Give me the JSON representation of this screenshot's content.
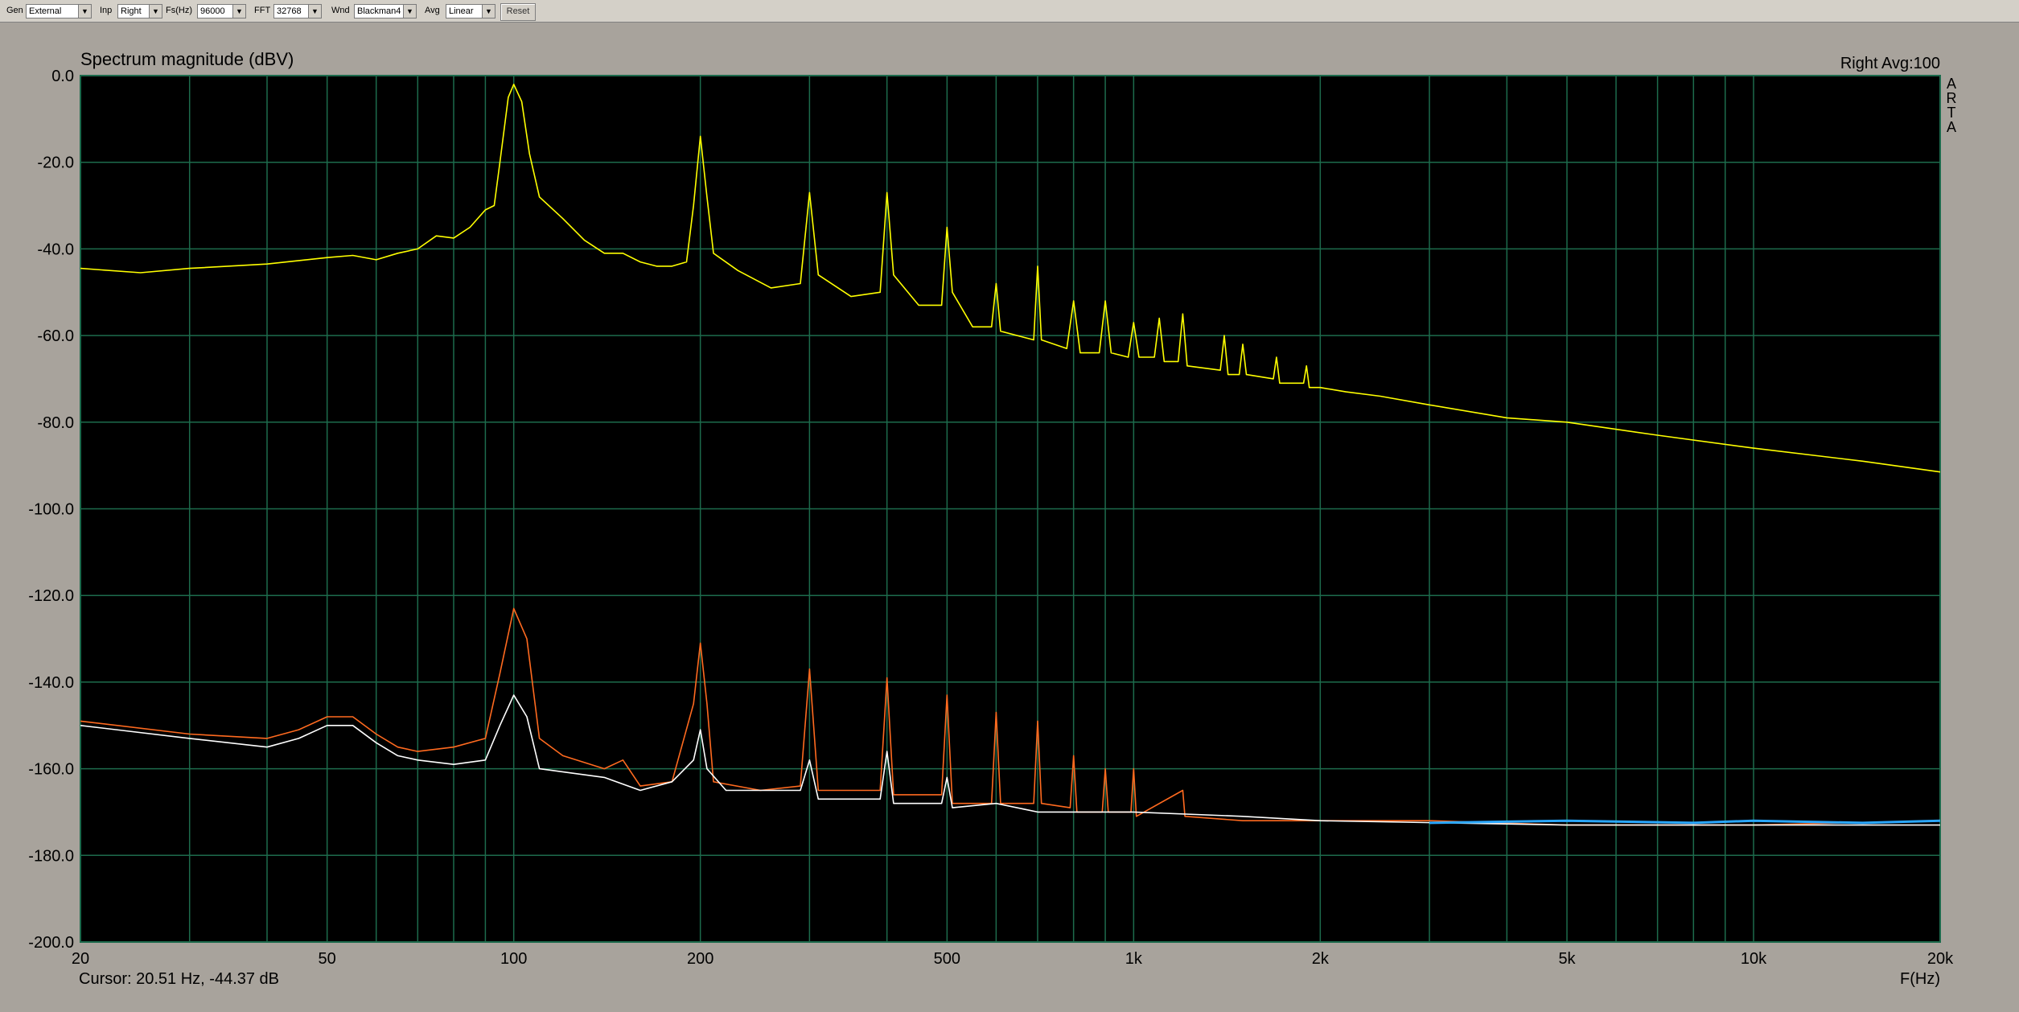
{
  "toolbar": {
    "gen_label": "Gen",
    "gen_value": "External",
    "inp_label": "Inp",
    "inp_value": "Right",
    "fs_label": "Fs(Hz)",
    "fs_value": "96000",
    "fft_label": "FFT",
    "fft_value": "32768",
    "wnd_label": "Wnd",
    "wnd_value": "Blackman4",
    "avg_label": "Avg",
    "avg_value": "Linear",
    "reset_label": "Reset"
  },
  "side_logo": "ARTA",
  "colors": {
    "background": "#000000",
    "grid": "#1d6b4c",
    "yellow": "#ffff00",
    "orange": "#ff6a1f",
    "white": "#ffffff",
    "blue": "#2aa7ff"
  },
  "chart_data": {
    "type": "line",
    "title": "Spectrum magnitude (dBV)",
    "channel_info": "Right  Avg:100",
    "xlabel": "F(Hz)",
    "x_scale": "log",
    "xlim": [
      20,
      20000
    ],
    "ylim": [
      -200,
      0
    ],
    "y_ticks": [
      "0.0",
      "-20.0",
      "-40.0",
      "-60.0",
      "-80.0",
      "-100.0",
      "-120.0",
      "-140.0",
      "-160.0",
      "-180.0",
      "-200.0"
    ],
    "x_tick_labels": [
      "20",
      "50",
      "100",
      "200",
      "500",
      "1k",
      "2k",
      "5k",
      "10k",
      "20k"
    ],
    "x_tick_values": [
      20,
      50,
      100,
      200,
      500,
      1000,
      2000,
      5000,
      10000,
      20000
    ],
    "grid": true,
    "cursor_text": "Cursor: 20.51 Hz, -44.37 dB",
    "series": [
      {
        "color": "#ffff00",
        "points": [
          [
            20,
            -44.5
          ],
          [
            25,
            -45.5
          ],
          [
            30,
            -44.5
          ],
          [
            40,
            -43.5
          ],
          [
            50,
            -42
          ],
          [
            55,
            -41.5
          ],
          [
            60,
            -42.5
          ],
          [
            65,
            -41
          ],
          [
            70,
            -40
          ],
          [
            75,
            -37
          ],
          [
            80,
            -37.5
          ],
          [
            85,
            -35
          ],
          [
            90,
            -31
          ],
          [
            93,
            -30
          ],
          [
            95,
            -20
          ],
          [
            98,
            -5
          ],
          [
            100,
            -2
          ],
          [
            103,
            -6
          ],
          [
            106,
            -18
          ],
          [
            110,
            -28
          ],
          [
            120,
            -33
          ],
          [
            130,
            -38
          ],
          [
            140,
            -41
          ],
          [
            150,
            -41
          ],
          [
            160,
            -43
          ],
          [
            170,
            -44
          ],
          [
            180,
            -44
          ],
          [
            190,
            -43
          ],
          [
            195,
            -30
          ],
          [
            200,
            -14
          ],
          [
            205,
            -28
          ],
          [
            210,
            -41
          ],
          [
            230,
            -45
          ],
          [
            260,
            -49
          ],
          [
            290,
            -48
          ],
          [
            300,
            -27
          ],
          [
            310,
            -46
          ],
          [
            350,
            -51
          ],
          [
            390,
            -50
          ],
          [
            400,
            -27
          ],
          [
            410,
            -46
          ],
          [
            450,
            -53
          ],
          [
            490,
            -53
          ],
          [
            500,
            -35
          ],
          [
            510,
            -50
          ],
          [
            550,
            -58
          ],
          [
            590,
            -58
          ],
          [
            600,
            -48
          ],
          [
            610,
            -59
          ],
          [
            690,
            -61
          ],
          [
            700,
            -44
          ],
          [
            710,
            -61
          ],
          [
            780,
            -63
          ],
          [
            800,
            -52
          ],
          [
            820,
            -64
          ],
          [
            880,
            -64
          ],
          [
            900,
            -52
          ],
          [
            920,
            -64
          ],
          [
            980,
            -65
          ],
          [
            1000,
            -57
          ],
          [
            1020,
            -65
          ],
          [
            1080,
            -65
          ],
          [
            1100,
            -56
          ],
          [
            1120,
            -66
          ],
          [
            1180,
            -66
          ],
          [
            1200,
            -55
          ],
          [
            1220,
            -67
          ],
          [
            1380,
            -68
          ],
          [
            1400,
            -60
          ],
          [
            1420,
            -69
          ],
          [
            1480,
            -69
          ],
          [
            1500,
            -62
          ],
          [
            1520,
            -69
          ],
          [
            1680,
            -70
          ],
          [
            1700,
            -65
          ],
          [
            1720,
            -71
          ],
          [
            1880,
            -71
          ],
          [
            1900,
            -67
          ],
          [
            1920,
            -72
          ],
          [
            2000,
            -72
          ],
          [
            2200,
            -73
          ],
          [
            2500,
            -74
          ],
          [
            3000,
            -76
          ],
          [
            4000,
            -79
          ],
          [
            5000,
            -80
          ],
          [
            7000,
            -83
          ],
          [
            10000,
            -86
          ],
          [
            15000,
            -89
          ],
          [
            20000,
            -91.5
          ]
        ]
      },
      {
        "color": "#ff6a1f",
        "points": [
          [
            20,
            -149
          ],
          [
            30,
            -152
          ],
          [
            40,
            -153
          ],
          [
            45,
            -151
          ],
          [
            50,
            -148
          ],
          [
            55,
            -148
          ],
          [
            60,
            -152
          ],
          [
            65,
            -155
          ],
          [
            70,
            -156
          ],
          [
            80,
            -155
          ],
          [
            90,
            -153
          ],
          [
            95,
            -138
          ],
          [
            100,
            -123
          ],
          [
            105,
            -130
          ],
          [
            110,
            -153
          ],
          [
            120,
            -157
          ],
          [
            140,
            -160
          ],
          [
            150,
            -158
          ],
          [
            160,
            -164
          ],
          [
            180,
            -163
          ],
          [
            195,
            -145
          ],
          [
            200,
            -131
          ],
          [
            205,
            -145
          ],
          [
            210,
            -163
          ],
          [
            250,
            -165
          ],
          [
            290,
            -164
          ],
          [
            300,
            -137
          ],
          [
            310,
            -165
          ],
          [
            350,
            -165
          ],
          [
            390,
            -165
          ],
          [
            400,
            -139
          ],
          [
            410,
            -166
          ],
          [
            490,
            -166
          ],
          [
            500,
            -143
          ],
          [
            510,
            -168
          ],
          [
            590,
            -168
          ],
          [
            600,
            -147
          ],
          [
            610,
            -168
          ],
          [
            690,
            -168
          ],
          [
            700,
            -149
          ],
          [
            710,
            -168
          ],
          [
            790,
            -169
          ],
          [
            800,
            -157
          ],
          [
            810,
            -170
          ],
          [
            890,
            -170
          ],
          [
            900,
            -160
          ],
          [
            910,
            -170
          ],
          [
            990,
            -170
          ],
          [
            1000,
            -160
          ],
          [
            1010,
            -171
          ],
          [
            1200,
            -165
          ],
          [
            1210,
            -171
          ],
          [
            1500,
            -172
          ],
          [
            2000,
            -172
          ],
          [
            3000,
            -172
          ],
          [
            5000,
            -173
          ],
          [
            10000,
            -173
          ],
          [
            20000,
            -172
          ]
        ]
      },
      {
        "color": "#ffffff",
        "points": [
          [
            20,
            -150
          ],
          [
            30,
            -153
          ],
          [
            40,
            -155
          ],
          [
            45,
            -153
          ],
          [
            50,
            -150
          ],
          [
            55,
            -150
          ],
          [
            60,
            -154
          ],
          [
            65,
            -157
          ],
          [
            70,
            -158
          ],
          [
            80,
            -159
          ],
          [
            90,
            -158
          ],
          [
            95,
            -150
          ],
          [
            100,
            -143
          ],
          [
            105,
            -148
          ],
          [
            110,
            -160
          ],
          [
            140,
            -162
          ],
          [
            160,
            -165
          ],
          [
            180,
            -163
          ],
          [
            195,
            -158
          ],
          [
            200,
            -151
          ],
          [
            205,
            -160
          ],
          [
            220,
            -165
          ],
          [
            290,
            -165
          ],
          [
            300,
            -158
          ],
          [
            310,
            -167
          ],
          [
            390,
            -167
          ],
          [
            400,
            -156
          ],
          [
            410,
            -168
          ],
          [
            490,
            -168
          ],
          [
            500,
            -162
          ],
          [
            510,
            -169
          ],
          [
            600,
            -168
          ],
          [
            700,
            -170
          ],
          [
            800,
            -170
          ],
          [
            900,
            -170
          ],
          [
            1000,
            -170
          ],
          [
            1500,
            -171
          ],
          [
            2000,
            -172
          ],
          [
            5000,
            -173
          ],
          [
            10000,
            -173
          ],
          [
            20000,
            -173
          ]
        ]
      },
      {
        "color": "#2aa7ff",
        "points": [
          [
            3000,
            -172.5
          ],
          [
            5000,
            -172
          ],
          [
            8000,
            -172.5
          ],
          [
            10000,
            -172
          ],
          [
            15000,
            -172.5
          ],
          [
            20000,
            -172
          ]
        ]
      }
    ]
  }
}
